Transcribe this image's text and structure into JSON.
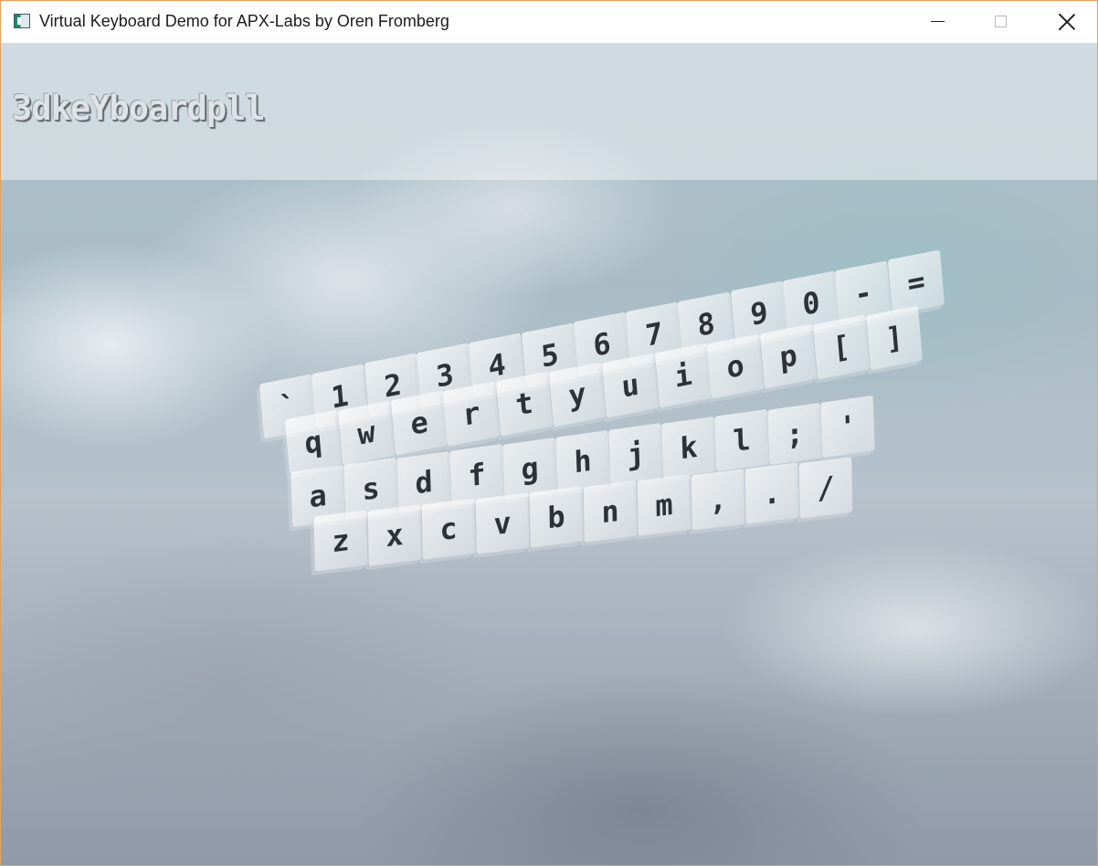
{
  "window": {
    "title": "Virtual Keyboard Demo for APX-Labs by Oren Fromberg"
  },
  "app": {
    "label": "3dkeYboardpll"
  },
  "keyboard": {
    "rows": [
      [
        "`",
        "1",
        "2",
        "3",
        "4",
        "5",
        "6",
        "7",
        "8",
        "9",
        "0",
        "-",
        "="
      ],
      [
        "q",
        "w",
        "e",
        "r",
        "t",
        "y",
        "u",
        "i",
        "o",
        "p",
        "[",
        "]"
      ],
      [
        "a",
        "s",
        "d",
        "f",
        "g",
        "h",
        "j",
        "k",
        "l",
        ";",
        "'"
      ],
      [
        "z",
        "x",
        "c",
        "v",
        "b",
        "n",
        "m",
        ",",
        ".",
        "/"
      ]
    ]
  }
}
